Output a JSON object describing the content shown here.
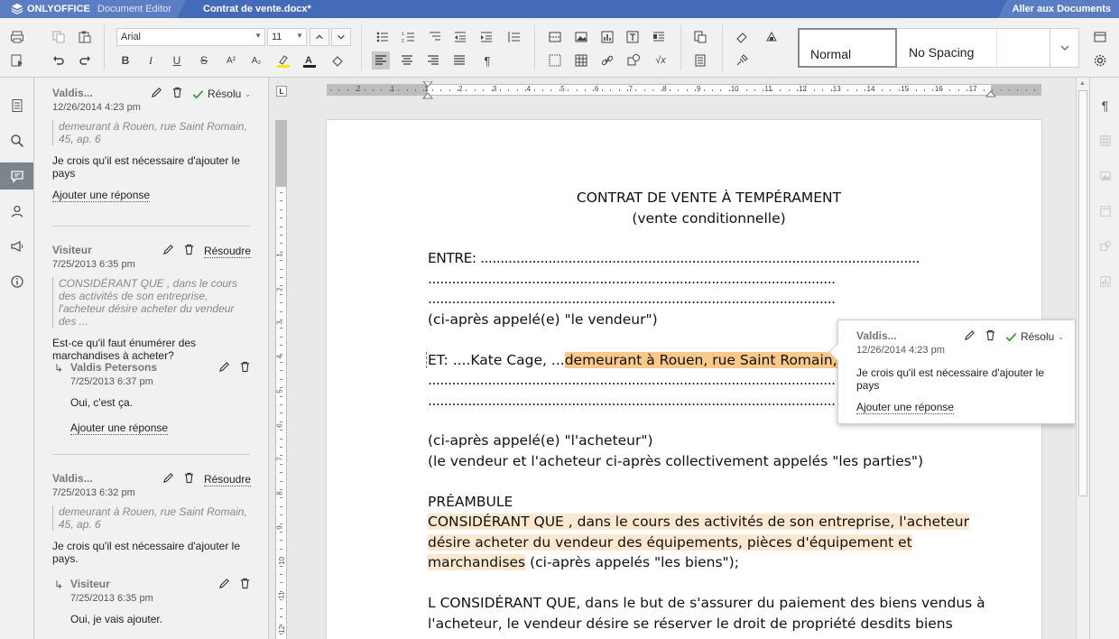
{
  "titlebar": {
    "brand": "ONLYOFFICE",
    "app": "Document Editor",
    "doc_title": "Contrat de vente.docx*",
    "goto_docs": "Aller aux Documents"
  },
  "toolbar": {
    "font_name": "Arial",
    "font_size": "11",
    "styles": [
      "Normal",
      "No Spacing"
    ],
    "bold": "B",
    "italic": "I",
    "underline": "U",
    "strike": "S",
    "superscript": "A²",
    "subscript": "A₂"
  },
  "comments": [
    {
      "author": "Valdis...",
      "date": "12/26/2014 4:23 pm",
      "status": "Résolu",
      "quote": "demeurant  à Rouen, rue Saint Romain, 45, ap. 6",
      "text": "Je crois qu'il est nécessaire d'ajouter le pays",
      "reply_link": "Ajouter une réponse"
    },
    {
      "author": "Visiteur",
      "date": "7/25/2013 6:35 pm",
      "status": "Résoudre",
      "quote": "CONSIDÉRANT QUE , dans le cours des activités de son entreprise, l'acheteur désire acheter du  vendeur  des ...",
      "text": "Est-ce qu'il faut énumérer des marchandises à acheter?",
      "reply": {
        "author": "Valdis Petersons",
        "date": "7/25/2013 6:37 pm",
        "text": "Oui, c'est ça."
      },
      "reply_link": "Ajouter une réponse"
    },
    {
      "author": "Valdis...",
      "date": "7/25/2013 6:32 pm",
      "status": "Résoudre",
      "quote": "demeurant  à Rouen, rue Saint Romain, 45, ap. 6",
      "text": "Je crois qu'il est nécessaire d'ajouter le pays.",
      "reply": {
        "author": "Visiteur",
        "date": "7/25/2013 6:35 pm",
        "text": "Oui, je vais ajouter."
      }
    }
  ],
  "popup": {
    "author": "Valdis...",
    "date": "12/26/2014 4:23 pm",
    "status": "Résolu",
    "text": "Je crois qu'il est nécessaire d'ajouter le pays",
    "reply_link": "Ajouter une réponse"
  },
  "document": {
    "title": "CONTRAT DE VENTE À TEMPÉRAMENT",
    "subtitle": "(vente conditionnelle)",
    "entre": "ENTRE: ..............................................................................................................",
    "dots_1": "......................................................................................................",
    "dots_2": "......................................................................................................",
    "vendeur": "(ci-après appelé(e) \"le vendeur\")",
    "et_prefix": "ET: ....Kate Cage, ...",
    "et_highlight": "demeurant  à Rouen, rue Saint Romain, 4",
    "dots_3": "......................................................................................................",
    "dots_4": "......................................................................................................",
    "acheteur": "(ci-après appelé(e) \"l'acheteur\")",
    "parties": "(le vendeur et l'acheteur ci-après collectivement appelés \"les parties\")",
    "preambule": "PRÉAMBULE",
    "consid_1": "CONSIDÉRANT QUE , dans le cours des activités de son entreprise, l'acheteur",
    "consid_2": "désire acheter du  vendeur  des  équipements,  pièces  d'équipement et",
    "consid_3a": "marchandises",
    "consid_3b": " (ci-après appelés \"les biens\");",
    "consid2_1": "L CONSIDÉRANT QUE, dans le but de s'assurer du paiement des biens vendus à",
    "consid2_2": "l'acheteur, le vendeur désire se réserver le droit de propriété desdits biens"
  },
  "hruler_numbers": [
    "2",
    "1",
    "1",
    "2",
    "3",
    "4",
    "5",
    "6",
    "7",
    "8",
    "9",
    "10",
    "11",
    "12",
    "13",
    "14",
    "15",
    "16",
    "17"
  ],
  "vruler_numbers": [
    "1",
    "2",
    "3",
    "4",
    "5",
    "6",
    "7",
    "8",
    "9",
    "10",
    "11",
    "12",
    "13"
  ]
}
